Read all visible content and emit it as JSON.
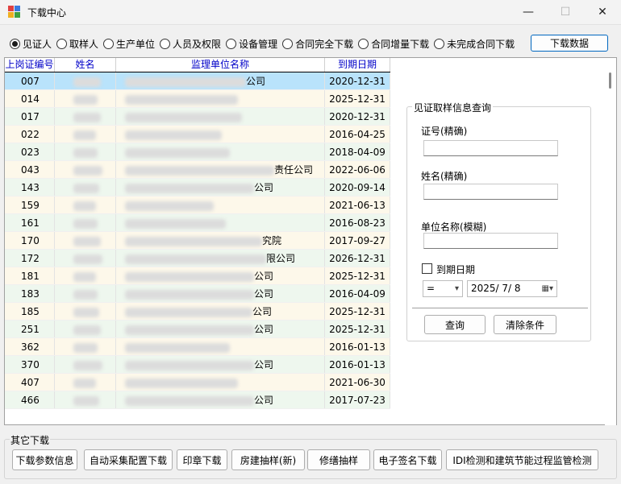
{
  "window": {
    "title": "下载中心",
    "minimize": "—",
    "maximize": "☐",
    "close": "✕"
  },
  "radios": [
    {
      "label": "见证人",
      "checked": true
    },
    {
      "label": "取样人",
      "checked": false
    },
    {
      "label": "生产单位",
      "checked": false
    },
    {
      "label": "人员及权限",
      "checked": false
    },
    {
      "label": "设备管理",
      "checked": false
    },
    {
      "label": "合同完全下载",
      "checked": false
    },
    {
      "label": "合同增量下载",
      "checked": false
    },
    {
      "label": "未完成合同下载",
      "checked": false
    }
  ],
  "download_button": "下载数据",
  "table": {
    "columns": [
      "上岗证编号",
      "姓名",
      "监理单位名称",
      "到期日期"
    ],
    "rows": [
      {
        "id": "007",
        "unit_suffix": "公司",
        "date": "2020-12-31"
      },
      {
        "id": "014",
        "unit_suffix": "",
        "date": "2025-12-31"
      },
      {
        "id": "017",
        "unit_suffix": "",
        "date": "2020-12-31"
      },
      {
        "id": "022",
        "unit_suffix": "",
        "date": "2016-04-25"
      },
      {
        "id": "023",
        "unit_suffix": "",
        "date": "2018-04-09"
      },
      {
        "id": "043",
        "unit_suffix": "责任公司",
        "date": "2022-06-06"
      },
      {
        "id": "143",
        "unit_suffix": "公司",
        "date": "2020-09-14"
      },
      {
        "id": "159",
        "unit_suffix": "",
        "date": "2021-06-13"
      },
      {
        "id": "161",
        "unit_suffix": "",
        "date": "2016-08-23"
      },
      {
        "id": "170",
        "unit_suffix": "究院",
        "date": "2017-09-27"
      },
      {
        "id": "172",
        "unit_suffix": "限公司",
        "date": "2026-12-31"
      },
      {
        "id": "181",
        "unit_suffix": "公司",
        "date": "2025-12-31"
      },
      {
        "id": "183",
        "unit_suffix": "公司",
        "date": "2016-04-09"
      },
      {
        "id": "185",
        "unit_suffix": "公司",
        "date": "2025-12-31"
      },
      {
        "id": "251",
        "unit_suffix": "公司",
        "date": "2025-12-31"
      },
      {
        "id": "362",
        "unit_suffix": "",
        "date": "2016-01-13"
      },
      {
        "id": "370",
        "unit_suffix": "公司",
        "date": "2016-01-13"
      },
      {
        "id": "407",
        "unit_suffix": "",
        "date": "2021-06-30"
      },
      {
        "id": "466",
        "unit_suffix": "公司",
        "date": "2017-07-23"
      }
    ]
  },
  "query": {
    "title": "见证取样信息查询",
    "cert_label": "证号(精确)",
    "name_label": "姓名(精确)",
    "unit_label": "单位名称(模糊)",
    "expiry_label": "到期日期",
    "operator": "=",
    "date": "2025/ 7/ 8",
    "search_button": "查询",
    "clear_button": "清除条件"
  },
  "other": {
    "label": "其它下载",
    "buttons": [
      "下载参数信息",
      "自动采集配置下载",
      "印章下载",
      "房建抽样(新)",
      "修缮抽样",
      "电子签名下载",
      "IDI检测和建筑节能过程监管检测"
    ]
  }
}
